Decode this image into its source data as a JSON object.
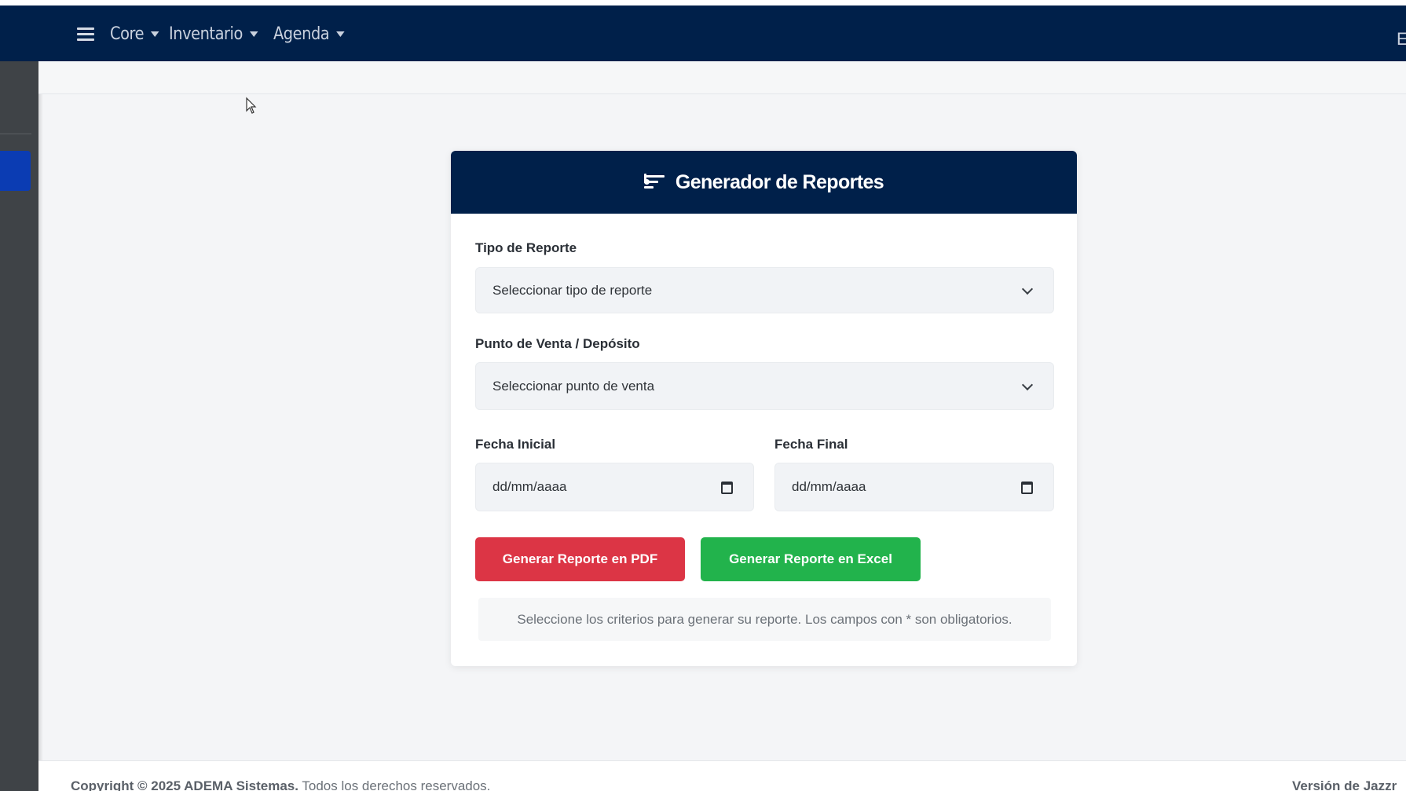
{
  "navbar": {
    "menu": [
      {
        "label": "Core"
      },
      {
        "label": "Inventario"
      },
      {
        "label": "Agenda"
      }
    ],
    "right_text": "E"
  },
  "card": {
    "title": "Generador de Reportes",
    "icon": "report-list-icon",
    "tipo_reporte": {
      "label": "Tipo de Reporte",
      "selected": "Seleccionar tipo de reporte"
    },
    "punto_venta": {
      "label": "Punto de Venta / Depósito",
      "selected": "Seleccionar punto de venta"
    },
    "fecha_inicial": {
      "label": "Fecha Inicial",
      "placeholder": "dd/mm/aaaa"
    },
    "fecha_final": {
      "label": "Fecha Final",
      "placeholder": "dd/mm/aaaa"
    },
    "btn_pdf": "Generar Reporte en PDF",
    "btn_excel": "Generar Reporte en Excel",
    "hint": "Seleccione los criterios para generar su reporte. Los campos con * son obligatorios."
  },
  "footer": {
    "copyright_bold": "Copyright © 2025 ADEMA Sistemas.",
    "copyright_rest": " Todos los derechos reservados.",
    "version": "Versión de Jazzr"
  },
  "colors": {
    "navbar": "#00204a",
    "sidebar": "#3f4347",
    "sidebar_active": "#0b3cb3",
    "pdf_button": "#dc3545",
    "excel_button": "#22b34c"
  }
}
